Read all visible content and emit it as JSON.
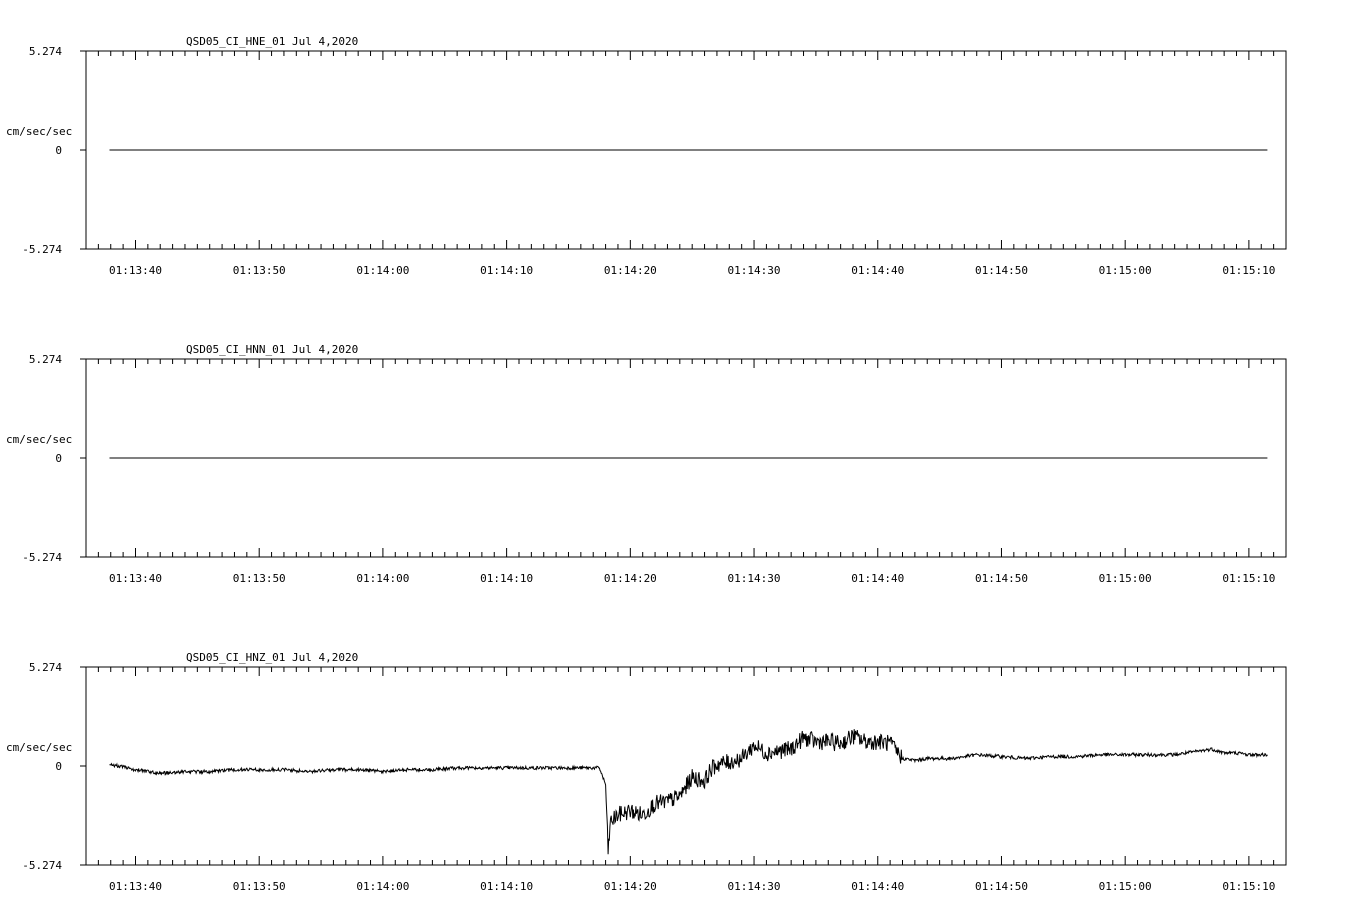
{
  "chart_data": [
    {
      "type": "line",
      "title": "QSD05_CI_HNE_01  Jul 4,2020",
      "ylabel": "cm/sec/sec",
      "ylim": [
        -5.274,
        5.274
      ],
      "y_ticks": [
        "5.274",
        "0",
        "-5.274"
      ],
      "x_ticks": [
        "01:13:40",
        "01:13:50",
        "01:14:00",
        "01:14:10",
        "01:14:20",
        "01:14:30",
        "01:14:40",
        "01:14:50",
        "01:15:00",
        "01:15:10"
      ],
      "x_range_s": [
        -4,
        93
      ],
      "trace_start_s": -2.1,
      "trace_end_s": 91.5,
      "series": [
        {
          "points": [
            [
              -2.1,
              0.0
            ],
            [
              91.5,
              0.0
            ]
          ]
        }
      ]
    },
    {
      "type": "line",
      "title": "QSD05_CI_HNN_01  Jul 4,2020",
      "ylabel": "cm/sec/sec",
      "ylim": [
        -5.274,
        5.274
      ],
      "y_ticks": [
        "5.274",
        "0",
        "-5.274"
      ],
      "x_ticks": [
        "01:13:40",
        "01:13:50",
        "01:14:00",
        "01:14:10",
        "01:14:20",
        "01:14:30",
        "01:14:40",
        "01:14:50",
        "01:15:00",
        "01:15:10"
      ],
      "x_range_s": [
        -4,
        93
      ],
      "trace_start_s": -2.1,
      "trace_end_s": 91.5,
      "series": [
        {
          "points": [
            [
              -2.1,
              0.0
            ],
            [
              91.5,
              0.0
            ]
          ]
        }
      ]
    },
    {
      "type": "line",
      "title": "QSD05_CI_HNZ_01  Jul 4,2020",
      "ylabel": "cm/sec/sec",
      "ylim": [
        -5.274,
        5.274
      ],
      "y_ticks": [
        "5.274",
        "0",
        "-5.274"
      ],
      "x_ticks": [
        "01:13:40",
        "01:13:50",
        "01:14:00",
        "01:14:10",
        "01:14:20",
        "01:14:30",
        "01:14:40",
        "01:14:50",
        "01:15:00",
        "01:15:10"
      ],
      "x_range_s": [
        -4,
        93
      ],
      "trace_start_s": -2.1,
      "trace_end_s": 91.5,
      "series": [
        {
          "points": [
            [
              -2.1,
              0.1
            ],
            [
              0,
              -0.2
            ],
            [
              2,
              -0.4
            ],
            [
              4,
              -0.3
            ],
            [
              6,
              -0.3
            ],
            [
              8,
              -0.2
            ],
            [
              10,
              -0.2
            ],
            [
              12,
              -0.2
            ],
            [
              14,
              -0.3
            ],
            [
              16,
              -0.2
            ],
            [
              18,
              -0.2
            ],
            [
              20,
              -0.3
            ],
            [
              22,
              -0.2
            ],
            [
              24,
              -0.2
            ],
            [
              26,
              -0.1
            ],
            [
              28,
              -0.1
            ],
            [
              30,
              -0.1
            ],
            [
              32,
              -0.1
            ],
            [
              34,
              -0.1
            ],
            [
              36,
              -0.1
            ],
            [
              37.5,
              -0.1
            ],
            [
              38,
              -1.0
            ],
            [
              38.2,
              -4.5
            ],
            [
              38.4,
              -3.0
            ],
            [
              39,
              -2.6
            ],
            [
              40,
              -2.4
            ],
            [
              41,
              -2.6
            ],
            [
              42,
              -2.0
            ],
            [
              43,
              -1.9
            ],
            [
              44,
              -1.6
            ],
            [
              45,
              -0.6
            ],
            [
              46,
              -0.8
            ],
            [
              46.5,
              -0.2
            ],
            [
              47,
              0.1
            ],
            [
              48,
              0.2
            ],
            [
              49,
              0.4
            ],
            [
              50,
              1.1
            ],
            [
              51,
              0.7
            ],
            [
              52,
              0.8
            ],
            [
              53,
              0.9
            ],
            [
              54,
              1.5
            ],
            [
              55,
              1.3
            ],
            [
              56,
              1.3
            ],
            [
              57,
              1.2
            ],
            [
              58,
              1.6
            ],
            [
              59,
              1.3
            ],
            [
              60,
              1.3
            ],
            [
              61,
              1.2
            ],
            [
              62,
              0.4
            ],
            [
              63,
              0.3
            ],
            [
              64,
              0.4
            ],
            [
              66,
              0.4
            ],
            [
              68,
              0.6
            ],
            [
              70,
              0.5
            ],
            [
              72,
              0.4
            ],
            [
              74,
              0.5
            ],
            [
              76,
              0.5
            ],
            [
              78,
              0.6
            ],
            [
              80,
              0.6
            ],
            [
              82,
              0.6
            ],
            [
              84,
              0.6
            ],
            [
              86,
              0.8
            ],
            [
              87,
              0.9
            ],
            [
              88,
              0.7
            ],
            [
              89,
              0.7
            ],
            [
              90,
              0.6
            ],
            [
              91.5,
              0.6
            ]
          ]
        }
      ]
    }
  ]
}
